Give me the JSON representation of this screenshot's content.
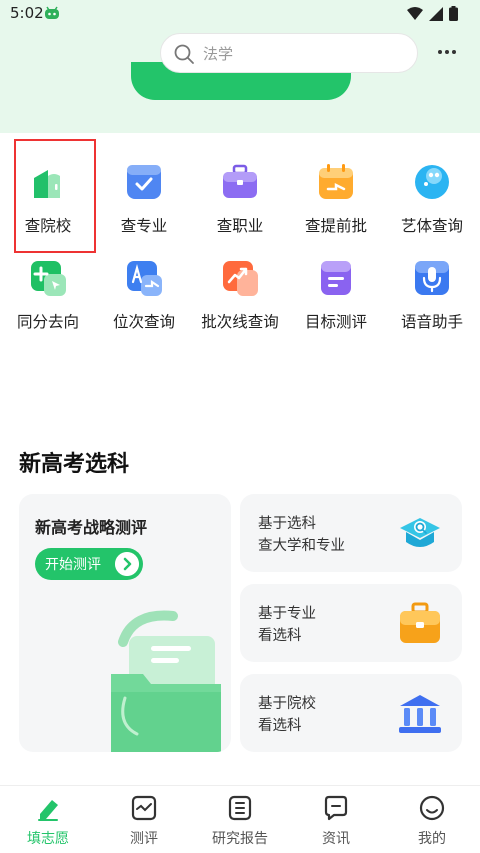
{
  "status_bar": {
    "time": "5:02"
  },
  "search": {
    "placeholder": "法学"
  },
  "grid": {
    "row1": [
      {
        "label": "查院校"
      },
      {
        "label": "查专业"
      },
      {
        "label": "查职业"
      },
      {
        "label": "查提前批"
      },
      {
        "label": "艺体查询"
      }
    ],
    "row2": [
      {
        "label": "同分去向"
      },
      {
        "label": "位次查询"
      },
      {
        "label": "批次线查询"
      },
      {
        "label": "目标测评"
      },
      {
        "label": "语音助手"
      }
    ]
  },
  "section": {
    "title": "新高考选科"
  },
  "strategy_card": {
    "title": "新高考战略测评",
    "button_label": "开始测评"
  },
  "side_cards": [
    {
      "line1": "基于选科",
      "line2": "查大学和专业"
    },
    {
      "line1": "基于专业",
      "line2": "看选科"
    },
    {
      "line1": "基于院校",
      "line2": "看选科"
    }
  ],
  "tabbar": {
    "items": [
      {
        "label": "填志愿"
      },
      {
        "label": "测评"
      },
      {
        "label": "研究报告"
      },
      {
        "label": "资讯"
      },
      {
        "label": "我的"
      }
    ]
  },
  "colors": {
    "brand": "#23c46a",
    "highlight": "#ee3333"
  }
}
